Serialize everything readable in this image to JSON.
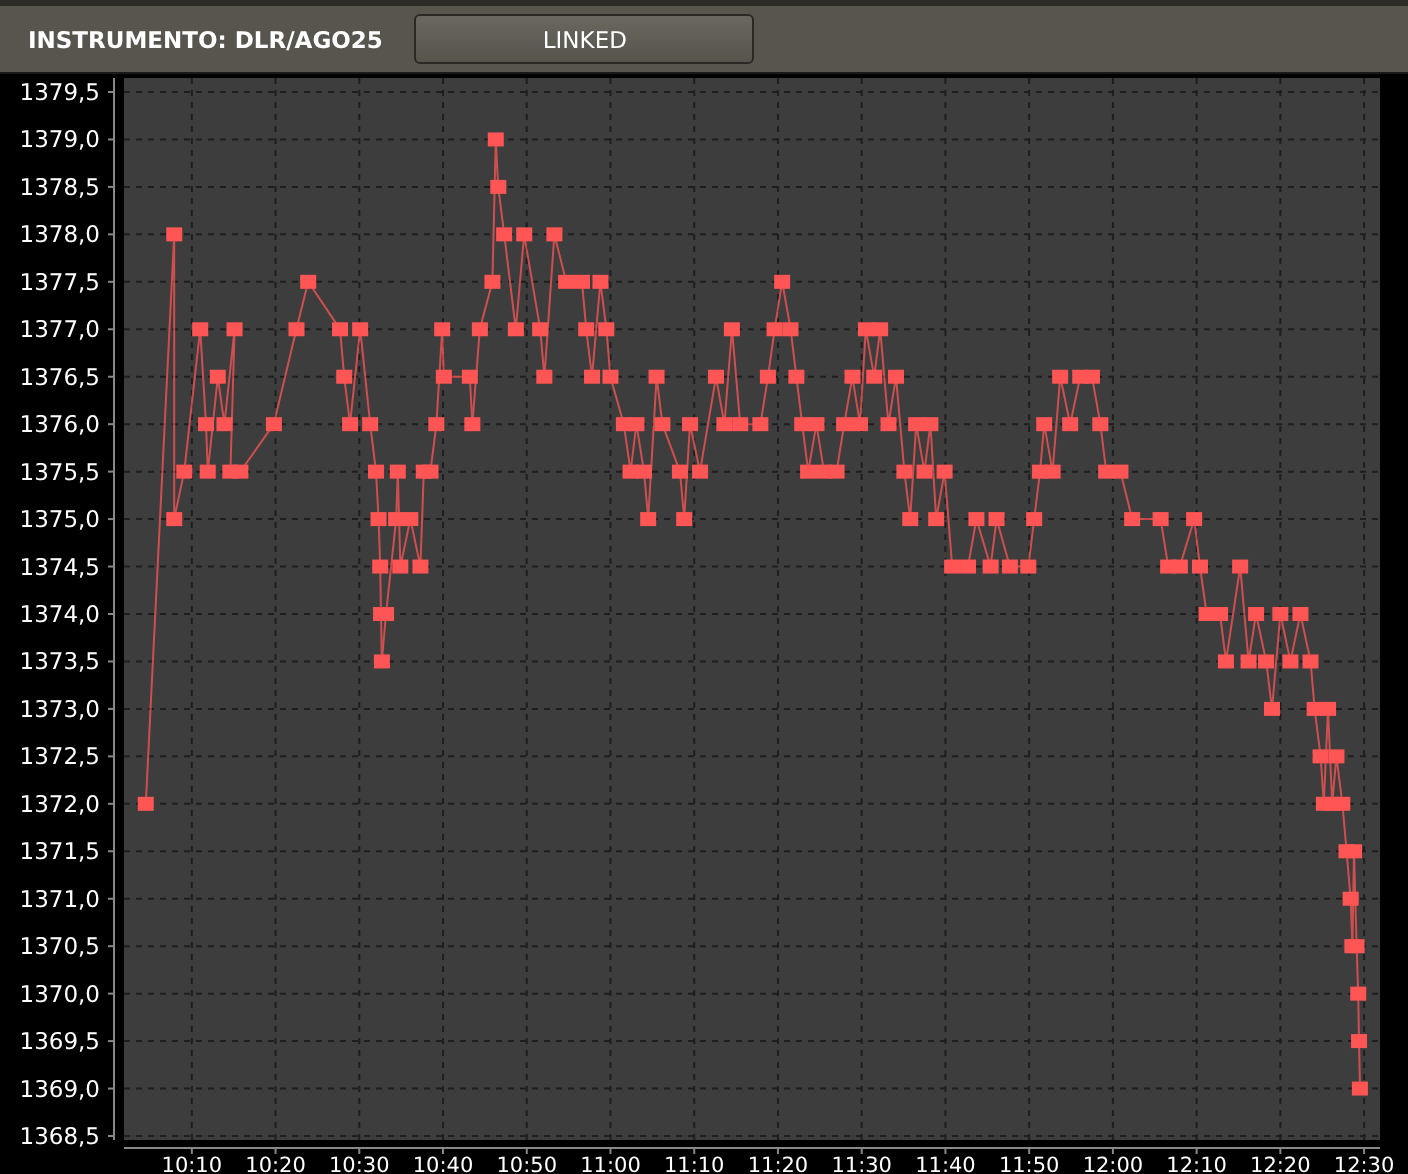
{
  "header": {
    "instrument_label": "INSTRUMENTO: DLR/AGO25",
    "link_button": "LINKED"
  },
  "chart": {
    "chart_data": {
      "type": "line",
      "x": [
        604.5,
        607.9,
        607.9,
        609.1,
        611.0,
        611.7,
        611.9,
        613.1,
        613.9,
        615.1,
        614.6,
        615.8,
        619.8,
        622.5,
        623.9,
        627.7,
        628.2,
        628.9,
        630.1,
        631.3,
        632.0,
        632.3,
        632.5,
        632.6,
        632.7,
        633.2,
        634.4,
        634.6,
        634.9,
        636.1,
        637.3,
        637.7,
        638.5,
        639.2,
        639.9,
        640.1,
        643.2,
        643.5,
        644.4,
        645.9,
        646.3,
        646.6,
        647.3,
        648.7,
        649.7,
        651.6,
        652.1,
        653.3,
        654.7,
        656.6,
        657.1,
        657.8,
        658.8,
        659.5,
        660.0,
        661.6,
        662.4,
        663.1,
        664.0,
        664.5,
        665.5,
        666.2,
        668.3,
        668.8,
        669.5,
        670.7,
        672.6,
        673.6,
        674.5,
        675.5,
        677.9,
        678.8,
        679.6,
        680.5,
        681.5,
        682.2,
        682.9,
        683.6,
        684.6,
        685.5,
        687.0,
        687.9,
        688.9,
        689.8,
        690.5,
        691.5,
        692.2,
        693.2,
        694.1,
        695.1,
        695.8,
        696.5,
        697.5,
        698.2,
        698.9,
        699.9,
        700.8,
        702.7,
        703.7,
        705.4,
        706.1,
        707.7,
        709.9,
        710.6,
        711.3,
        711.8,
        712.8,
        713.7,
        714.9,
        716.1,
        717.5,
        718.5,
        719.2,
        720.9,
        722.3,
        725.7,
        726.6,
        728.0,
        729.7,
        730.4,
        731.2,
        732.8,
        733.5,
        735.2,
        736.2,
        737.1,
        738.3,
        739.0,
        740.0,
        741.2,
        742.4,
        743.6,
        744.1,
        744.8,
        745.2,
        745.7,
        746.2,
        746.7,
        747.4,
        747.9,
        748.4,
        748.6,
        748.8,
        749.1,
        749.3,
        749.4,
        749.5
      ],
      "grid": true,
      "series": [
        {
          "color": "#ff5555",
          "marker": "square",
          "values": [
            1372.0,
            1378.0,
            1375.0,
            1375.5,
            1377.0,
            1376.0,
            1375.5,
            1376.5,
            1376.0,
            1377.0,
            1375.5,
            1375.5,
            1376.0,
            1377.0,
            1377.5,
            1377.0,
            1376.5,
            1376.0,
            1377.0,
            1376.0,
            1375.5,
            1375.0,
            1374.5,
            1374.0,
            1373.5,
            1374.0,
            1375.0,
            1375.5,
            1374.5,
            1375.0,
            1374.5,
            1375.5,
            1375.5,
            1376.0,
            1377.0,
            1376.5,
            1376.5,
            1376.0,
            1377.0,
            1377.5,
            1379.0,
            1378.5,
            1378.0,
            1377.0,
            1378.0,
            1377.0,
            1376.5,
            1378.0,
            1377.5,
            1377.5,
            1377.0,
            1376.5,
            1377.5,
            1377.0,
            1376.5,
            1376.0,
            1375.5,
            1376.0,
            1375.5,
            1375.0,
            1376.5,
            1376.0,
            1375.5,
            1375.0,
            1376.0,
            1375.5,
            1376.5,
            1376.0,
            1377.0,
            1376.0,
            1376.0,
            1376.5,
            1377.0,
            1377.5,
            1377.0,
            1376.5,
            1376.0,
            1375.5,
            1376.0,
            1375.5,
            1375.5,
            1376.0,
            1376.5,
            1376.0,
            1377.0,
            1376.5,
            1377.0,
            1376.0,
            1376.5,
            1375.5,
            1375.0,
            1376.0,
            1375.5,
            1376.0,
            1375.0,
            1375.5,
            1374.5,
            1374.5,
            1375.0,
            1374.5,
            1375.0,
            1374.5,
            1374.5,
            1375.0,
            1375.5,
            1376.0,
            1375.5,
            1376.5,
            1376.0,
            1376.5,
            1376.5,
            1376.0,
            1375.5,
            1375.5,
            1375.0,
            1375.0,
            1374.5,
            1374.5,
            1375.0,
            1374.5,
            1374.0,
            1374.0,
            1373.5,
            1374.5,
            1373.5,
            1374.0,
            1373.5,
            1373.0,
            1374.0,
            1373.5,
            1374.0,
            1373.5,
            1373.0,
            1372.5,
            1372.0,
            1373.0,
            1372.0,
            1372.5,
            1372.0,
            1371.5,
            1371.0,
            1370.5,
            1371.5,
            1370.5,
            1370.0,
            1369.5,
            1369.0
          ]
        }
      ],
      "xlim": [
        601.9,
        751.9
      ],
      "ylim": [
        1368.5,
        1379.5
      ],
      "xticks": [
        {
          "value": 610,
          "label": "10:10"
        },
        {
          "value": 620,
          "label": "10:20"
        },
        {
          "value": 630,
          "label": "10:30"
        },
        {
          "value": 640,
          "label": "10:40"
        },
        {
          "value": 650,
          "label": "10:50"
        },
        {
          "value": 660,
          "label": "11:00"
        },
        {
          "value": 670,
          "label": "11:10"
        },
        {
          "value": 680,
          "label": "11:20"
        },
        {
          "value": 690,
          "label": "11:30"
        },
        {
          "value": 700,
          "label": "11:40"
        },
        {
          "value": 710,
          "label": "11:50"
        },
        {
          "value": 720,
          "label": "12:00"
        },
        {
          "value": 730,
          "label": "12:10"
        },
        {
          "value": 740,
          "label": "12:20"
        },
        {
          "value": 750,
          "label": "12:30"
        }
      ],
      "yticks": [
        {
          "value": 1368.5,
          "label": "1368,5"
        },
        {
          "value": 1369.0,
          "label": "1369,0"
        },
        {
          "value": 1369.5,
          "label": "1369,5"
        },
        {
          "value": 1370.0,
          "label": "1370,0"
        },
        {
          "value": 1370.5,
          "label": "1370,5"
        },
        {
          "value": 1371.0,
          "label": "1371,0"
        },
        {
          "value": 1371.5,
          "label": "1371,5"
        },
        {
          "value": 1372.0,
          "label": "1372,0"
        },
        {
          "value": 1372.5,
          "label": "1372,5"
        },
        {
          "value": 1373.0,
          "label": "1373,0"
        },
        {
          "value": 1373.5,
          "label": "1373,5"
        },
        {
          "value": 1374.0,
          "label": "1374,0"
        },
        {
          "value": 1374.5,
          "label": "1374,5"
        },
        {
          "value": 1375.0,
          "label": "1375,0"
        },
        {
          "value": 1375.5,
          "label": "1375,5"
        },
        {
          "value": 1376.0,
          "label": "1376,0"
        },
        {
          "value": 1376.5,
          "label": "1376,5"
        },
        {
          "value": 1377.0,
          "label": "1377,0"
        },
        {
          "value": 1377.5,
          "label": "1377,5"
        },
        {
          "value": 1378.0,
          "label": "1378,0"
        },
        {
          "value": 1378.5,
          "label": "1378,5"
        },
        {
          "value": 1379.0,
          "label": "1379,0"
        },
        {
          "value": 1379.5,
          "label": "1379,5"
        }
      ]
    }
  }
}
